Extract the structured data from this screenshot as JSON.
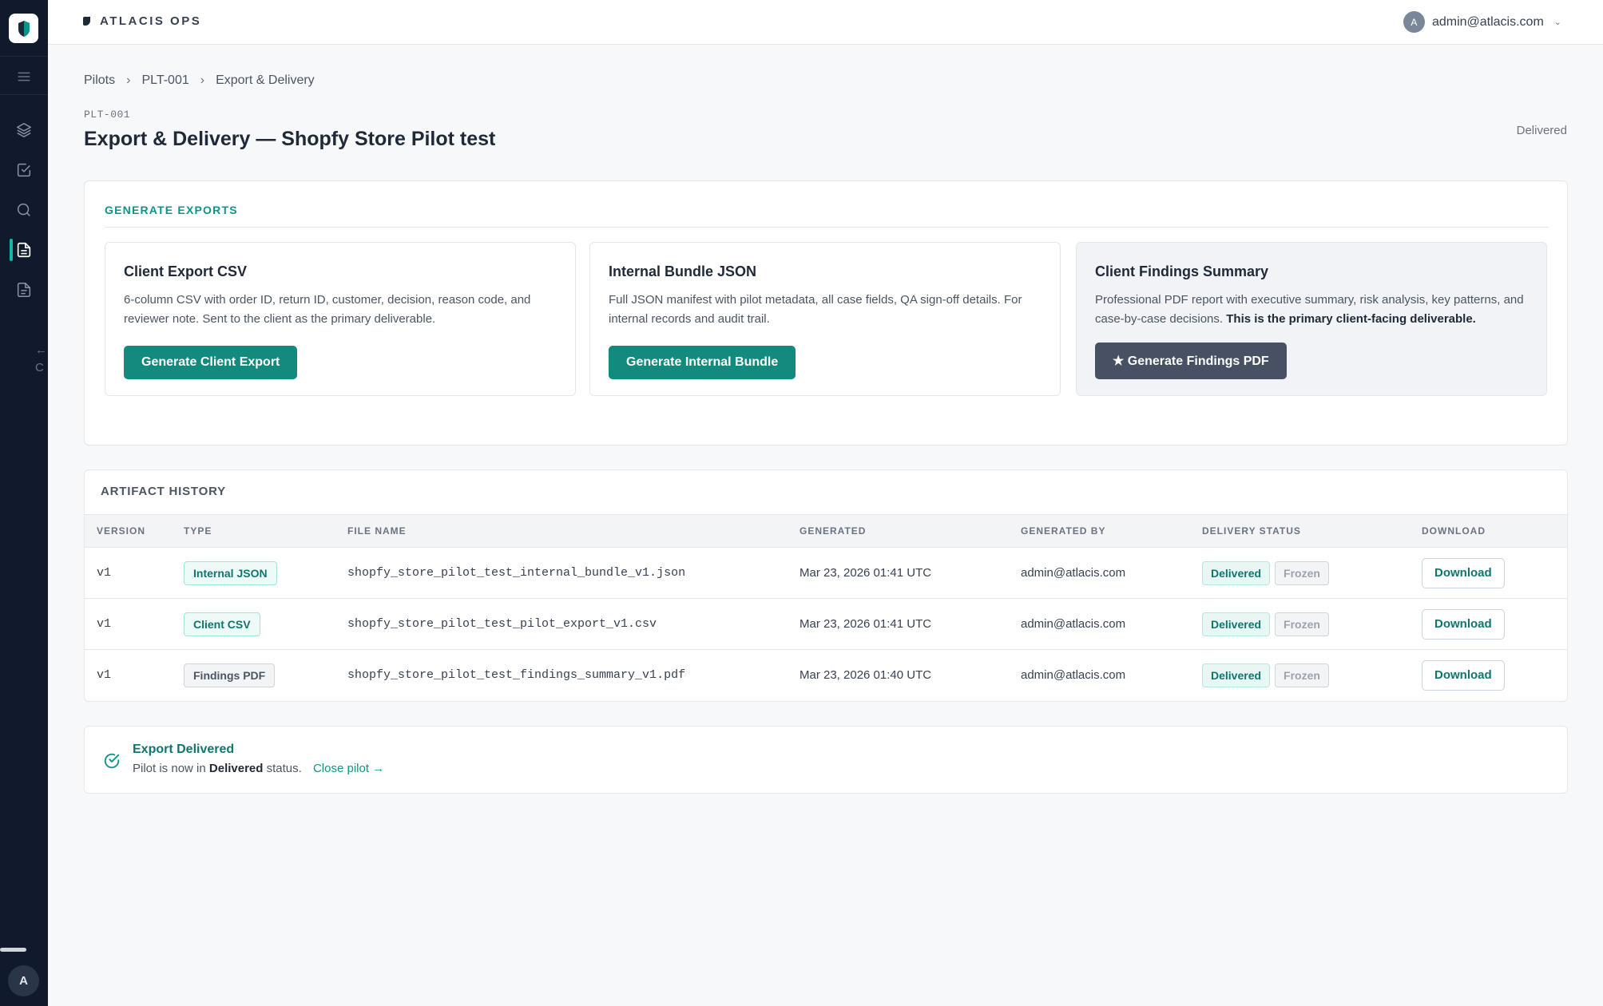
{
  "app": {
    "brand": "ATLACIS OPS",
    "user_email": "admin@atlacis.com",
    "user_initial": "A"
  },
  "sidebar": {
    "items": [
      {
        "icon": "menu-icon"
      },
      {
        "icon": "layers-icon"
      },
      {
        "icon": "checkbox-icon"
      },
      {
        "icon": "search-icon"
      },
      {
        "icon": "document-icon",
        "active": true
      },
      {
        "icon": "file-icon"
      }
    ],
    "collapse_label": "← C",
    "avatar_initial": "A"
  },
  "breadcrumb": {
    "items": [
      "Pilots",
      "PLT-001",
      "Export & Delivery"
    ],
    "separator": "›"
  },
  "header": {
    "pilot_code": "PLT-001",
    "title": "Export & Delivery — Shopfy Store Pilot test",
    "status": "Delivered"
  },
  "generate": {
    "section_title": "GENERATE EXPORTS",
    "cards": [
      {
        "title": "Client Export CSV",
        "description": "6-column CSV with order ID, return ID, customer, decision, reason code, and reviewer note. Sent to the client as the primary deliverable.",
        "button": "Generate Client Export"
      },
      {
        "title": "Internal Bundle JSON",
        "description": "Full JSON manifest with pilot metadata, all case fields, QA sign-off details. For internal records and audit trail.",
        "button": "Generate Internal Bundle"
      },
      {
        "title": "Client Findings Summary",
        "description": "Professional PDF report with executive summary, risk analysis, key patterns, and case-by-case decisions.",
        "description_bold": "This is the primary client-facing deliverable.",
        "button": "★ Generate Findings PDF"
      }
    ]
  },
  "artifacts": {
    "title": "ARTIFACT HISTORY",
    "columns": [
      "VERSION",
      "TYPE",
      "FILE NAME",
      "GENERATED",
      "GENERATED BY",
      "DELIVERY STATUS",
      "DOWNLOAD"
    ],
    "rows": [
      {
        "version": "v1",
        "type": "Internal JSON",
        "file": "shopfy_store_pilot_test_internal_bundle_v1.json",
        "generated": "Mar 23, 2026 01:41 UTC",
        "by": "admin@atlacis.com",
        "status": "Delivered",
        "lock": "Frozen",
        "action": "Download"
      },
      {
        "version": "v1",
        "type": "Client CSV",
        "file": "shopfy_store_pilot_test_pilot_export_v1.csv",
        "generated": "Mar 23, 2026 01:41 UTC",
        "by": "admin@atlacis.com",
        "status": "Delivered",
        "lock": "Frozen",
        "action": "Download"
      },
      {
        "version": "v1",
        "type": "Findings PDF",
        "file": "shopfy_store_pilot_test_findings_summary_v1.pdf",
        "generated": "Mar 23, 2026 01:40 UTC",
        "by": "admin@atlacis.com",
        "status": "Delivered",
        "lock": "Frozen",
        "action": "Download"
      }
    ]
  },
  "delivered": {
    "title": "Export Delivered",
    "text_before": "Pilot is now in",
    "text_bold": "Delivered",
    "text_after": "status.",
    "link": "Close pilot →"
  },
  "colors": {
    "accent": "#0d9488",
    "sidebar_bg": "#111a2c",
    "dark_button": "#475163"
  }
}
